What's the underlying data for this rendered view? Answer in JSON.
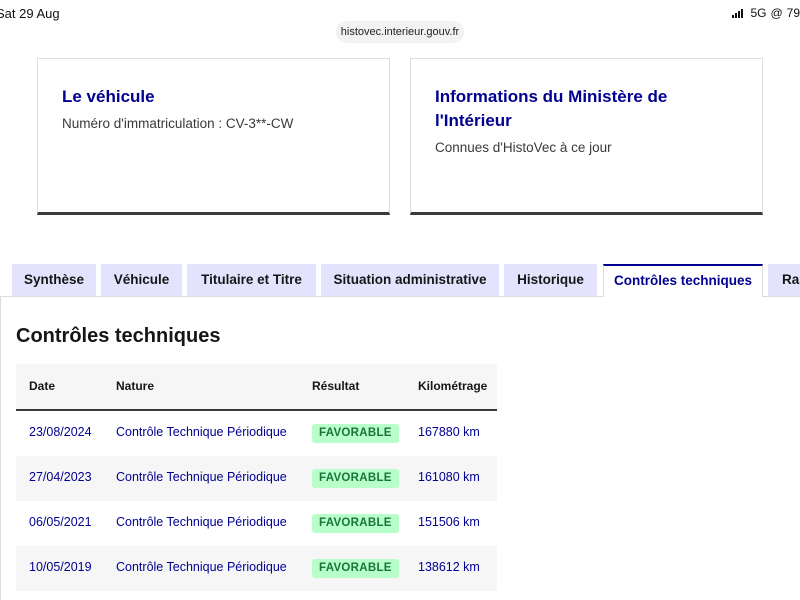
{
  "status_bar": {
    "time": "Sat 29 Aug",
    "network": "5G",
    "battery": "79"
  },
  "browser": {
    "url": "histovec.interieur.gouv.fr"
  },
  "cards": {
    "vehicle": {
      "title": "Le véhicule",
      "subtitle": "Numéro d'immatriculation : CV-3**-CW"
    },
    "ministry": {
      "title": "Informations du Ministère de l'Intérieur",
      "subtitle": "Connues d'HistoVec à ce jour"
    }
  },
  "tabs": [
    {
      "label": "Synthèse",
      "active": false
    },
    {
      "label": "Véhicule",
      "active": false
    },
    {
      "label": "Titulaire et Titre",
      "active": false
    },
    {
      "label": "Situation administrative",
      "active": false
    },
    {
      "label": "Historique",
      "active": false
    },
    {
      "label": "Contrôles techniques",
      "active": true
    },
    {
      "label": "Rapport",
      "active": false
    }
  ],
  "section_title": "Contrôles techniques",
  "table": {
    "headers": [
      "Date",
      "Nature",
      "Résultat",
      "Kilométrage"
    ],
    "rows": [
      {
        "date": "23/08/2024",
        "nature": "Contrôle Technique Périodique",
        "result": "FAVORABLE",
        "km": "167880 km"
      },
      {
        "date": "27/04/2023",
        "nature": "Contrôle Technique Périodique",
        "result": "FAVORABLE",
        "km": "161080 km"
      },
      {
        "date": "06/05/2021",
        "nature": "Contrôle Technique Périodique",
        "result": "FAVORABLE",
        "km": "151506 km"
      },
      {
        "date": "10/05/2019",
        "nature": "Contrôle Technique Périodique",
        "result": "FAVORABLE",
        "km": "138612 km"
      }
    ]
  },
  "colors": {
    "primary": "#000091",
    "tab_bg": "#e3e3fd",
    "success_bg": "#b8fec9",
    "success_text": "#18753c"
  }
}
